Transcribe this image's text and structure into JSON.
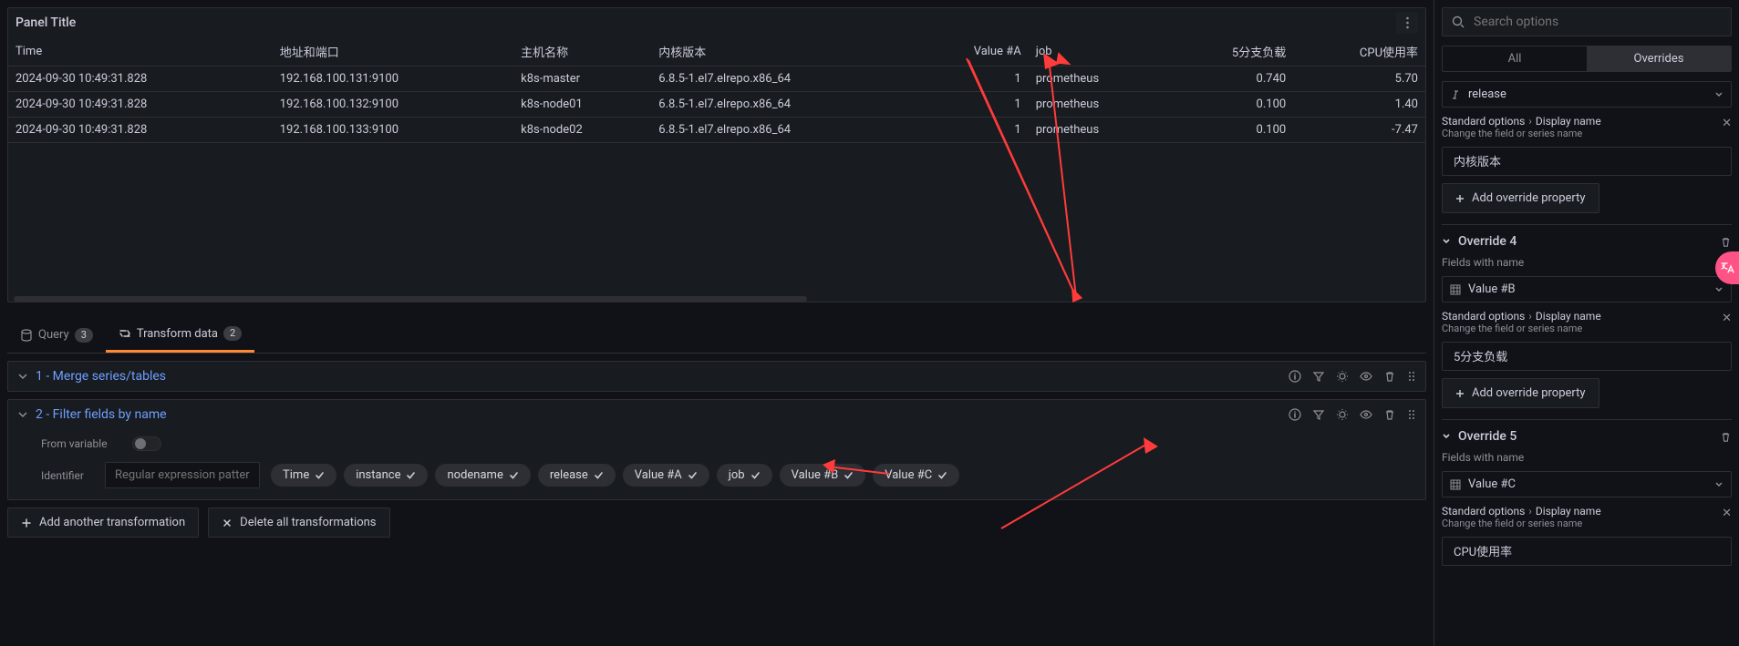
{
  "panel": {
    "title": "Panel Title"
  },
  "table": {
    "headers": [
      "Time",
      "地址和端口",
      "主机名称",
      "内核版本",
      "Value #A",
      "job",
      "5分支负载",
      "CPU使用率"
    ],
    "rows": [
      {
        "time": "2024-09-30 10:49:31.828",
        "addr": "192.168.100.131:9100",
        "host": "k8s-master",
        "kernel": "6.8.5-1.el7.elrepo.x86_64",
        "va": "1",
        "job": "prometheus",
        "load": "0.740",
        "cpu": "5.70"
      },
      {
        "time": "2024-09-30 10:49:31.828",
        "addr": "192.168.100.132:9100",
        "host": "k8s-node01",
        "kernel": "6.8.5-1.el7.elrepo.x86_64",
        "va": "1",
        "job": "prometheus",
        "load": "0.100",
        "cpu": "1.40"
      },
      {
        "time": "2024-09-30 10:49:31.828",
        "addr": "192.168.100.133:9100",
        "host": "k8s-node02",
        "kernel": "6.8.5-1.el7.elrepo.x86_64",
        "va": "1",
        "job": "prometheus",
        "load": "0.100",
        "cpu": "-7.47"
      }
    ]
  },
  "tabs": {
    "query": {
      "label": "Query",
      "count": "3"
    },
    "transform": {
      "label": "Transform data",
      "count": "2"
    }
  },
  "transforms": {
    "t1": {
      "title": "1 - Merge series/tables"
    },
    "t2": {
      "title": "2 - Filter fields by name",
      "from_variable": "From variable",
      "identifier": "Identifier",
      "identifier_placeholder": "Regular expression pattern",
      "chips": [
        "Time",
        "instance",
        "nodename",
        "release",
        "Value #A",
        "job",
        "Value #B",
        "Value #C"
      ]
    }
  },
  "bottom": {
    "add": "Add another transformation",
    "delete": "Delete all transformations"
  },
  "side": {
    "search_placeholder": "Search options",
    "seg_all": "All",
    "seg_overrides": "Overrides",
    "release_field": "release",
    "crumb_standard": "Standard options",
    "crumb_display": "Display name",
    "crumb_desc": "Change the field or series name",
    "add_prop": "Add override property",
    "fields_with_name": "Fields with name",
    "ov3_val": "内核版本",
    "ov4_title": "Override 4",
    "ov4_field": "Value #B",
    "ov4_val": "5分支负载",
    "ov5_title": "Override 5",
    "ov5_field": "Value #C",
    "ov5_val": "CPU使用率"
  }
}
